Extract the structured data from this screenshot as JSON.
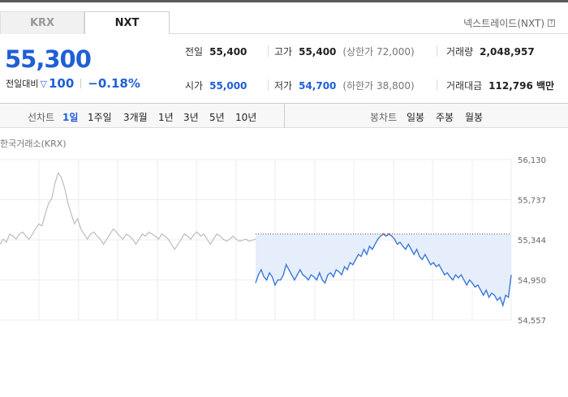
{
  "tabs": [
    {
      "label": "KRX",
      "active": false
    },
    {
      "label": "NXT",
      "active": true
    }
  ],
  "nxt_link": {
    "label": "넥스트레이드(NXT)",
    "help_icon": "question-icon"
  },
  "price": {
    "current": "55,300",
    "change_label": "전일대비",
    "direction_icon": "down-triangle-icon",
    "change": "100",
    "change_pct": "−0.18%"
  },
  "stats": {
    "prev_close_label": "전일",
    "prev_close": "55,400",
    "high_label": "고가",
    "high": "55,400",
    "upper_limit": "(상한가 72,000)",
    "volume_label": "거래량",
    "volume": "2,048,957",
    "open_label": "시가",
    "open": "55,000",
    "low_label": "저가",
    "low": "54,700",
    "lower_limit": "(하한가 38,800)",
    "amount_label": "거래대금",
    "amount": "112,796 백만"
  },
  "period": {
    "line_label": "선차트",
    "line_options": [
      "1일",
      "1주일",
      "3개월",
      "1년",
      "3년",
      "5년",
      "10년"
    ],
    "active": "1일",
    "candle_label": "봉차트",
    "candle_options": [
      "일봉",
      "주봉",
      "월봉"
    ]
  },
  "colors": {
    "accent": "#1f5fd6",
    "line": "#3a78d8",
    "fill": "#e6eefc",
    "krx_line": "#bdbdbd",
    "up": "#e34040"
  },
  "chart_data": {
    "type": "line",
    "title": "한국거래소(KRX)",
    "y_ticks": [
      "56,130",
      "55,737",
      "55,344",
      "54,950",
      "54,557"
    ],
    "ylim": [
      54557,
      56130
    ],
    "reference_line": 55400,
    "series": [
      {
        "values": [
          55300,
          55350,
          55320,
          55400,
          55380,
          55350,
          55400,
          55420,
          55380,
          55350,
          55400,
          55450,
          55500,
          55480,
          55600,
          55700,
          55750,
          55900,
          56000,
          55950,
          55850,
          55700,
          55600,
          55500,
          55550,
          55450,
          55400,
          55350,
          55400,
          55420,
          55380,
          55350,
          55300,
          55350,
          55400,
          55450,
          55420,
          55380,
          55350,
          55400,
          55380,
          55350,
          55300,
          55350,
          55400,
          55380,
          55420,
          55400,
          55380,
          55350,
          55400,
          55380,
          55350,
          55300,
          55250,
          55300,
          55350,
          55400,
          55380,
          55350,
          55400,
          55420,
          55380,
          55400,
          55350,
          55300,
          55350,
          55400,
          55380,
          55350,
          55330,
          55350,
          55380,
          55350,
          55330,
          55340,
          55350,
          55330,
          55340,
          55350
        ]
      },
      {
        "values": [
          54920,
          55000,
          55050,
          54980,
          54950,
          55020,
          54980,
          54900,
          54950,
          54950,
          55000,
          55100,
          55050,
          55000,
          54950,
          55000,
          55050,
          55000,
          54980,
          54950,
          55000,
          54980,
          54950,
          55020,
          54950,
          54920,
          55000,
          55020,
          54980,
          55050,
          55030,
          55000,
          55080,
          55050,
          55120,
          55100,
          55150,
          55200,
          55180,
          55250,
          55200,
          55280,
          55250,
          55300,
          55350,
          55380,
          55400,
          55380,
          55400,
          55380,
          55350,
          55300,
          55320,
          55280,
          55250,
          55300,
          55250,
          55200,
          55250,
          55180,
          55150,
          55200,
          55150,
          55100,
          55120,
          55080,
          55100,
          55050,
          55000,
          55020,
          54980,
          54950,
          55000,
          54970,
          55000,
          54950,
          54900,
          54950,
          54920,
          54880,
          54900,
          54850,
          54800,
          54850,
          54780,
          54820,
          54800,
          54750,
          54780,
          54700,
          54800,
          54780,
          55000
        ]
      }
    ]
  }
}
